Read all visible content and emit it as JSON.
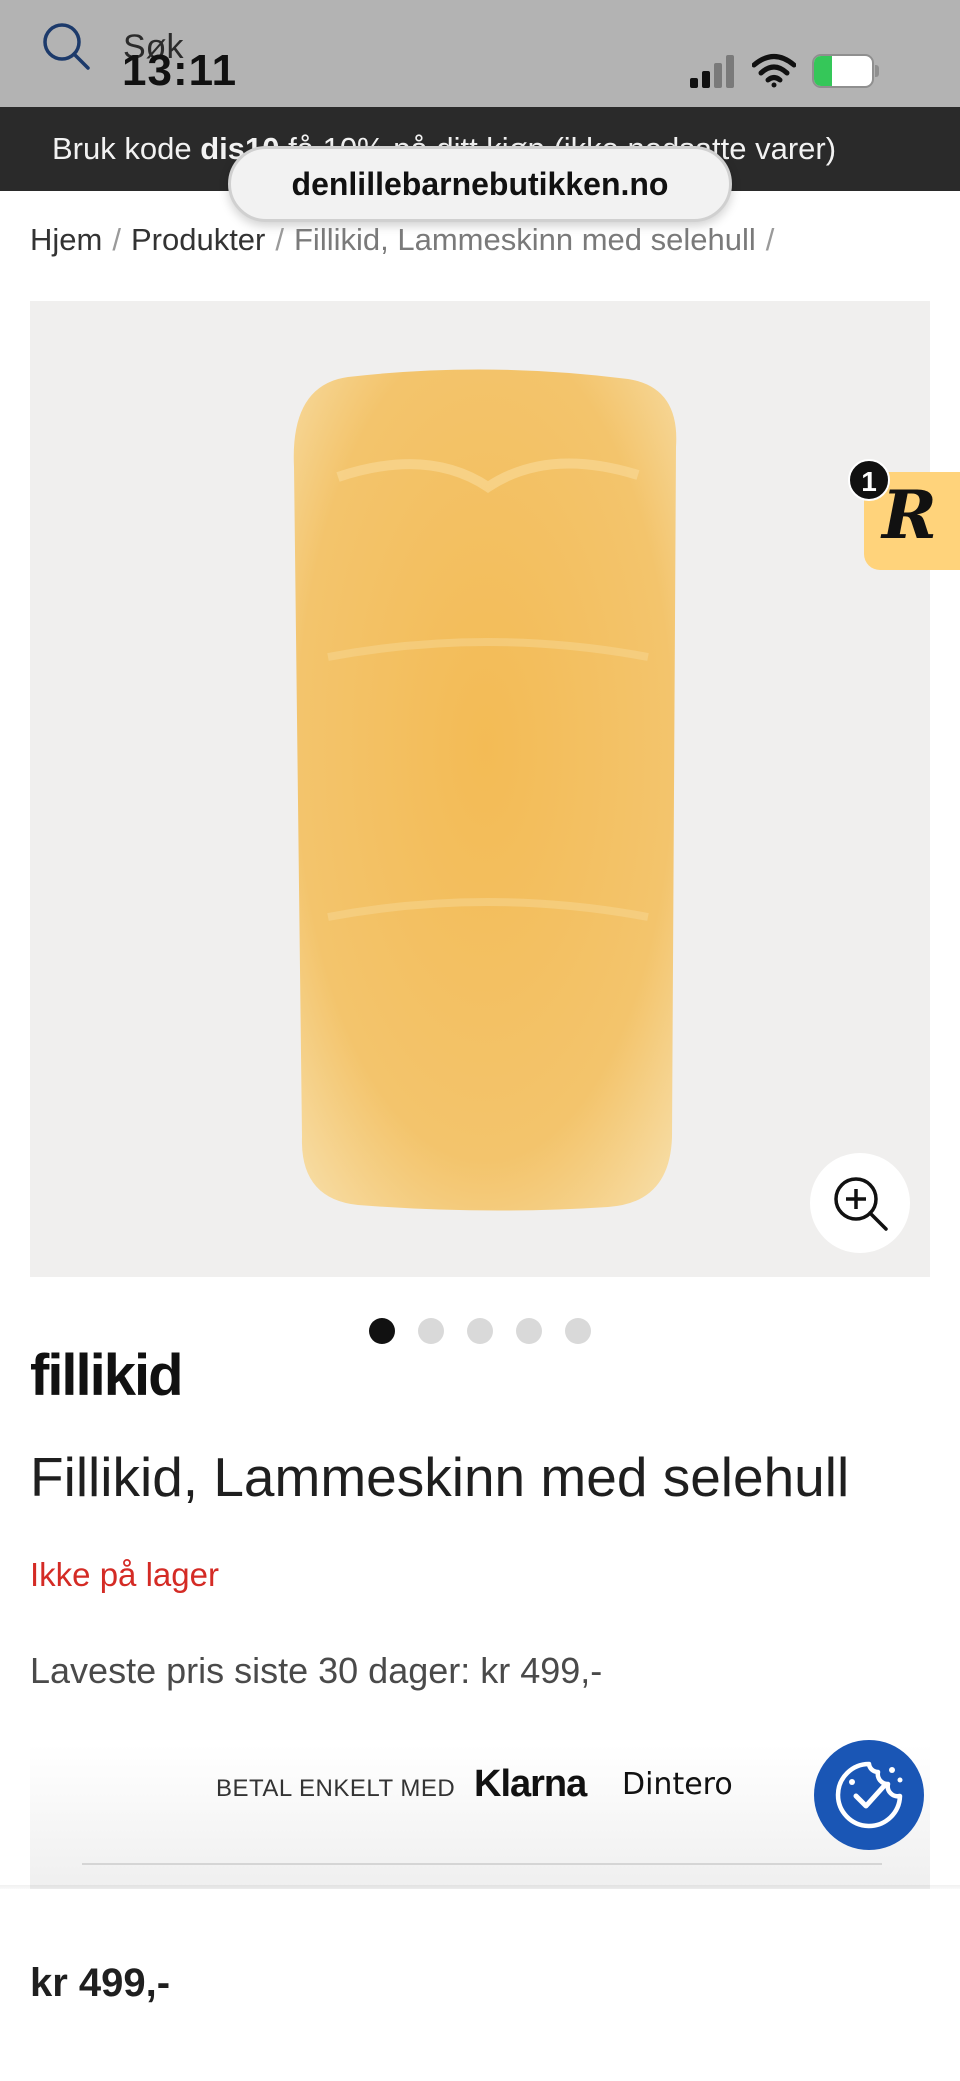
{
  "status_bar": {
    "time": "13:11",
    "search_label": "Søk",
    "battery_percent": 31,
    "battery_label": "31"
  },
  "promo": {
    "prefix": "Bruk kode",
    "code": "dis10",
    "suffix": "få 10% på ditt kjøp (ikke nedsatte varer)"
  },
  "browser": {
    "url": "denlillebarnebutikken.no"
  },
  "breadcrumb": {
    "home": "Hjem",
    "products": "Produkter",
    "current": "Fillikid, Lammeskinn med selehull",
    "separator": "/"
  },
  "reward_badge": {
    "letter": "R",
    "count": "1"
  },
  "gallery": {
    "total_images": 5,
    "active_index": 0
  },
  "product": {
    "brand": "fillikid",
    "title": "Fillikid, Lammeskinn med selehull",
    "stock": "Ikke på lager",
    "lowest_price_30_days": "Laveste pris siste 30 dager: kr 499,-",
    "price": "kr 499,-"
  },
  "payment": {
    "text": "BETAL ENKELT MED",
    "providers": [
      "Klarna",
      "Dintero"
    ]
  },
  "colors": {
    "promo_bg": "#2a2a2a",
    "stock_red": "#d42b25",
    "reward_yellow": "#ffd37b",
    "cookie_blue": "#1a56b5",
    "sheepskin": "#f1b95a"
  },
  "icons": {
    "search": "search-icon",
    "zoom": "zoom-in-icon",
    "cookie": "cookie-consent-icon",
    "signal": "cellular-signal-icon",
    "wifi": "wifi-icon",
    "battery": "battery-icon"
  }
}
